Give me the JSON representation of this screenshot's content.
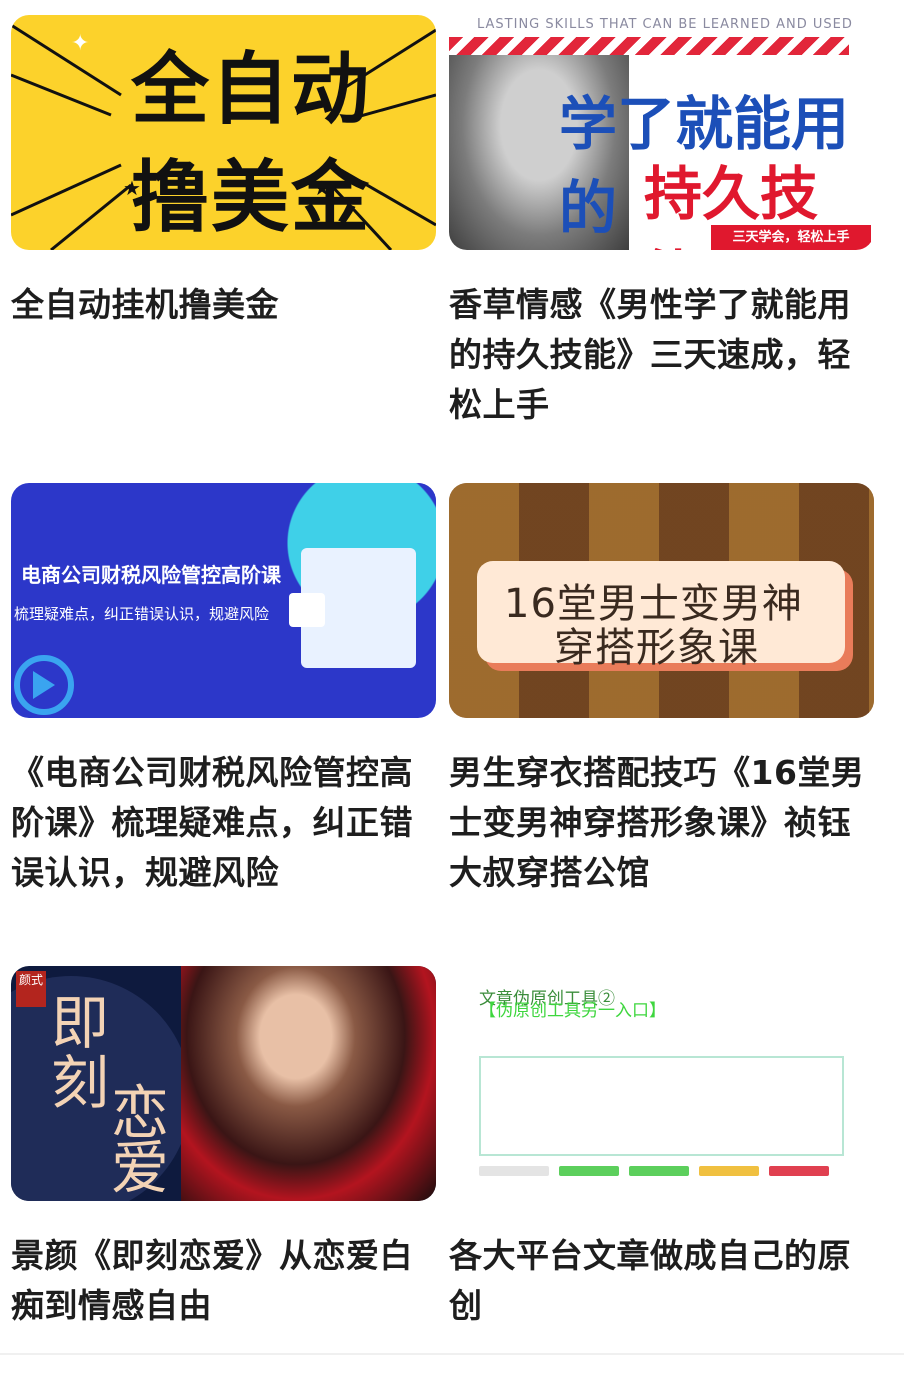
{
  "cards": [
    {
      "title": "全自动挂机撸美金",
      "thumb": {
        "line1": "全自动",
        "line2": "撸美金"
      }
    },
    {
      "title": "香草情感《男性学了就能用的持久技能》三天速成，轻松上手",
      "thumb": {
        "small": "LASTING SKILLS THAT CAN BE LEARNED AND USED",
        "line1": "学了就能用的",
        "line2": "持久技能",
        "tag": "三天学会，轻松上手"
      }
    },
    {
      "title": "《电商公司财税风险管控高阶课》梳理疑难点，纠正错误认识，规避风险",
      "thumb": {
        "heading": "电商公司财税风险管控高阶课",
        "sub": "梳理疑难点，纠正错误认识，规避风险"
      }
    },
    {
      "title": "男生穿衣搭配技巧《16堂男士变男神穿搭形象课》祯钰大叔穿搭公馆",
      "thumb": {
        "line1": "16堂男士变男神",
        "line2": "穿搭形象课"
      }
    },
    {
      "title": "景颜《即刻恋爱》从恋爱白痴到情感自由",
      "thumb": {
        "seal": "颜式",
        "c1": "即",
        "c2": "刻",
        "c3": "恋",
        "c4": "爱"
      }
    },
    {
      "title": "各大平台文章做成自己的原创",
      "thumb": {
        "line1": "文章伪原创工具②",
        "line2": "【伪原创工具另一入口】"
      }
    }
  ]
}
